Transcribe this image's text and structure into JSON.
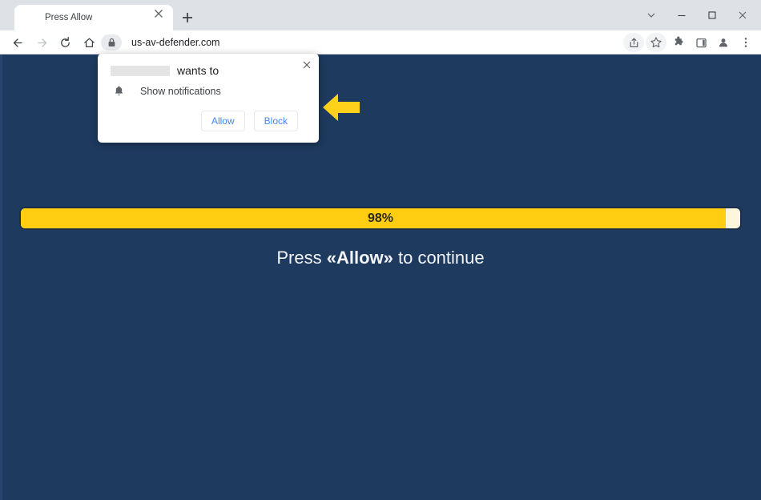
{
  "window": {
    "controls": [
      {
        "name": "tab-search",
        "glyph": "⌄"
      },
      {
        "name": "minimize",
        "glyph": "–"
      },
      {
        "name": "maximize",
        "glyph": "□"
      },
      {
        "name": "close",
        "glyph": "✕"
      }
    ]
  },
  "tabstrip": {
    "active_tab_title": "Press Allow",
    "close_glyph": "✕",
    "new_tab_glyph": "+"
  },
  "toolbar": {
    "url": "us-av-defender.com",
    "back_glyph": "←",
    "forward_glyph": "→",
    "reload_glyph": "⟳",
    "home_glyph": "⌂",
    "lock_glyph": "🔒",
    "icons": [
      {
        "name": "share-icon",
        "glyph": "↱"
      },
      {
        "name": "bookmark-icon",
        "glyph": "☆"
      },
      {
        "name": "extensions-icon",
        "glyph": "❖"
      },
      {
        "name": "side-panel-icon",
        "glyph": "▣"
      },
      {
        "name": "profile-icon",
        "glyph": "●"
      },
      {
        "name": "menu-icon",
        "glyph": "⋮"
      }
    ]
  },
  "permission_popup": {
    "origin_redacted": "",
    "headline_suffix": "wants to",
    "permission_label": "Show notifications",
    "bell_glyph": "🔔",
    "close_glyph": "✕",
    "allow_label": "Allow",
    "block_label": "Block",
    "accent_color": "#4285f4"
  },
  "page": {
    "background_color": "#1e3a5f",
    "progress": {
      "percent": 98,
      "label": "98%",
      "fill_color": "#ffcd11",
      "track_color": "#fdf6dd",
      "border_color": "#1a2e47"
    },
    "cta": {
      "prefix": "Press ",
      "emphasis": "«Allow»",
      "suffix": " to continue"
    },
    "arrow": {
      "direction": "left",
      "color": "#ffd11a"
    }
  }
}
